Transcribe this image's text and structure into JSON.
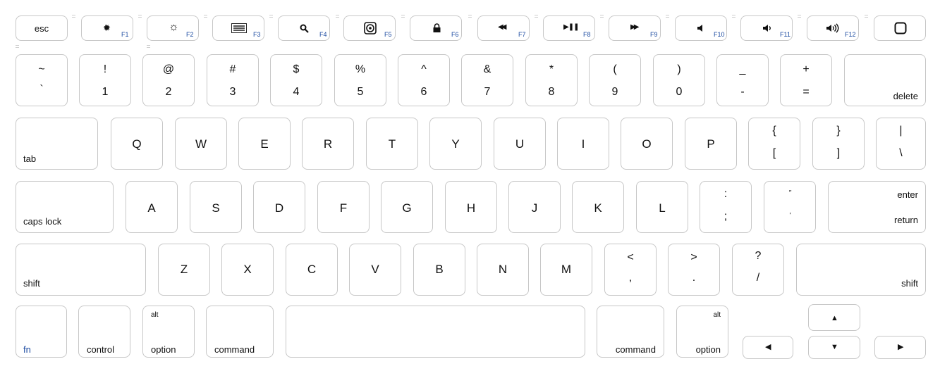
{
  "keyboard": {
    "fn_row": {
      "esc": "esc",
      "f1": "F1",
      "f2": "F2",
      "f3": "F3",
      "f4": "F4",
      "f5": "F5",
      "f6": "F6",
      "f7": "F7",
      "f8": "F8",
      "f9": "F9",
      "f10": "F10",
      "f11": "F11",
      "f12": "F12"
    },
    "number_row": [
      {
        "top": "~",
        "bottom": "`"
      },
      {
        "top": "!",
        "bottom": "1"
      },
      {
        "top": "@",
        "bottom": "2"
      },
      {
        "top": "#",
        "bottom": "3"
      },
      {
        "top": "$",
        "bottom": "4"
      },
      {
        "top": "%",
        "bottom": "5"
      },
      {
        "top": "^",
        "bottom": "6"
      },
      {
        "top": "&",
        "bottom": "7"
      },
      {
        "top": "*",
        "bottom": "8"
      },
      {
        "top": "(",
        "bottom": "9"
      },
      {
        "top": ")",
        "bottom": "0"
      },
      {
        "top": "_",
        "bottom": "-"
      },
      {
        "top": "+",
        "bottom": "="
      }
    ],
    "delete": "delete",
    "tab": "tab",
    "qrow": [
      "Q",
      "W",
      "E",
      "R",
      "T",
      "Y",
      "U",
      "I",
      "O",
      "P"
    ],
    "bracket_open": {
      "top": "{",
      "bottom": "["
    },
    "bracket_close": {
      "top": "}",
      "bottom": "]"
    },
    "backslash": {
      "top": "|",
      "bottom": "\\"
    },
    "caps_lock": "caps lock",
    "arow": [
      "A",
      "S",
      "D",
      "F",
      "G",
      "H",
      "J",
      "K",
      "L"
    ],
    "semicolon": {
      "top": ":",
      "bottom": ";"
    },
    "quote": {
      "top": "\"",
      "bottom": "'"
    },
    "enter": {
      "top": "enter",
      "bottom": "return"
    },
    "shift": "shift",
    "zrow": [
      "Z",
      "X",
      "C",
      "V",
      "B",
      "N",
      "M"
    ],
    "comma": {
      "top": "<",
      "bottom": ","
    },
    "period": {
      "top": ">",
      "bottom": "."
    },
    "slash": {
      "top": "?",
      "bottom": "/"
    },
    "fn": "fn",
    "control": "control",
    "alt": "alt",
    "option": "option",
    "command": "command",
    "colors": {
      "fn_accent": "#1b4aa0",
      "key_border": "#c7c7c7"
    }
  }
}
